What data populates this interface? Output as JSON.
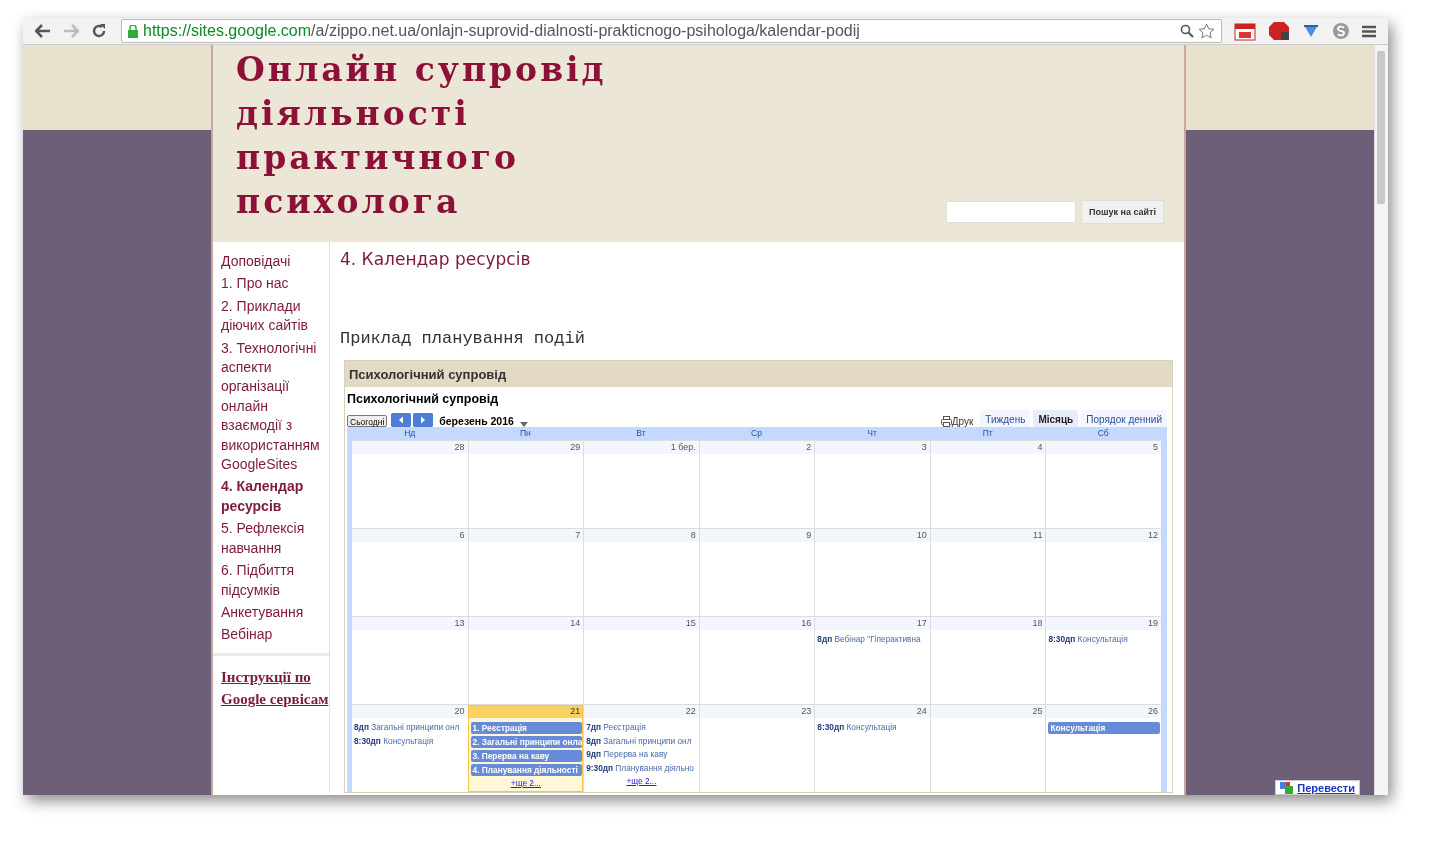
{
  "browser": {
    "url_host": "https://sites.google.com",
    "url_path": "/a/zippo.net.ua/onlajn-suprovid-dialnosti-prakticnogo-psihologa/kalendar-podij"
  },
  "site": {
    "title_lines": [
      "Онлайн супровід",
      "діяльності",
      "практичного",
      "психолога"
    ],
    "search_button": "Пошук на сайті"
  },
  "sidebar": {
    "items": [
      {
        "label": "Доповідачі",
        "selected": false
      },
      {
        "label": "1. Про нас",
        "selected": false
      },
      {
        "label": "2. Приклади діючих сайтів",
        "selected": false
      },
      {
        "label": "3. Технологічні аспекти організації онлайн взаємодії з використанням GoogleSites",
        "selected": false
      },
      {
        "label": "4. Календар ресурсів",
        "selected": true
      },
      {
        "label": "5. Рефлексія навчання",
        "selected": false
      },
      {
        "label": "6. Підбиття підсумків",
        "selected": false
      },
      {
        "label": "Анкетування",
        "selected": false
      },
      {
        "label": "Вебінар",
        "selected": false
      }
    ],
    "link": "Інструкції по Google сервісам"
  },
  "page": {
    "heading": "4. Календар ресурсів",
    "subheading": "Приклад планування подій"
  },
  "calendar": {
    "gadget_title": "Психологічний супровід",
    "title": "Психологічний супровід",
    "today_button": "Сьогодні",
    "month": "березень 2016",
    "print": "Друк",
    "views": [
      {
        "label": "Тиждень",
        "selected": false
      },
      {
        "label": "Місяць",
        "selected": true
      },
      {
        "label": "Порядок денний",
        "selected": false
      }
    ],
    "weekdays": [
      "Нд",
      "Пн",
      "Вт",
      "Ср",
      "Чт",
      "Пт",
      "Сб"
    ],
    "weeks": [
      [
        {
          "day": "28",
          "today": false
        },
        {
          "day": "29",
          "today": false
        },
        {
          "day": "1 бер.",
          "today": false
        },
        {
          "day": "2",
          "today": false
        },
        {
          "day": "3",
          "today": false
        },
        {
          "day": "4",
          "today": false
        },
        {
          "day": "5",
          "today": false
        }
      ],
      [
        {
          "day": "6",
          "today": false
        },
        {
          "day": "7",
          "today": false
        },
        {
          "day": "8",
          "today": false
        },
        {
          "day": "9",
          "today": false
        },
        {
          "day": "10",
          "today": false
        },
        {
          "day": "11",
          "today": false
        },
        {
          "day": "12",
          "today": false
        }
      ],
      [
        {
          "day": "13",
          "today": false
        },
        {
          "day": "14",
          "today": false
        },
        {
          "day": "15",
          "today": false
        },
        {
          "day": "16",
          "today": false
        },
        {
          "day": "17",
          "today": false,
          "events": [
            {
              "kind": "timed",
              "time": "8дп",
              "title": "Вебінар \"Гіперактивна"
            }
          ]
        },
        {
          "day": "18",
          "today": false
        },
        {
          "day": "19",
          "today": false,
          "events": [
            {
              "kind": "timed",
              "time": "8:30дп",
              "title": "Консультація"
            }
          ]
        }
      ],
      [
        {
          "day": "20",
          "today": false,
          "events": [
            {
              "kind": "timed",
              "time": "8дп",
              "title": "Загальні принципи онл"
            },
            {
              "kind": "timed",
              "time": "8:30дп",
              "title": "Консультація"
            }
          ]
        },
        {
          "day": "21",
          "today": true,
          "events": [
            {
              "kind": "block",
              "title": "1. Реєстрація"
            },
            {
              "kind": "block",
              "title": "2. Загальні принципи онла"
            },
            {
              "kind": "block",
              "title": "3. Перерва на каву"
            },
            {
              "kind": "block",
              "title": "4. Планування діяльності"
            }
          ],
          "more": "+ще 2..."
        },
        {
          "day": "22",
          "today": false,
          "events": [
            {
              "kind": "timed",
              "time": "7дп",
              "title": "Реєстрація"
            },
            {
              "kind": "timed",
              "time": "8дп",
              "title": "Загальні принципи онл"
            },
            {
              "kind": "timed",
              "time": "9дп",
              "title": "Перерва на каву"
            },
            {
              "kind": "timed",
              "time": "9:30дп",
              "title": "Планування діяльно"
            }
          ],
          "more": "+ще 2..."
        },
        {
          "day": "23",
          "today": false
        },
        {
          "day": "24",
          "today": false,
          "events": [
            {
              "kind": "timed",
              "time": "8:30дп",
              "title": "Консультація"
            }
          ]
        },
        {
          "day": "25",
          "today": false
        },
        {
          "day": "26",
          "today": false,
          "events": [
            {
              "kind": "block",
              "title": "Консультація"
            }
          ]
        }
      ]
    ]
  },
  "translate_button": "Перевести"
}
